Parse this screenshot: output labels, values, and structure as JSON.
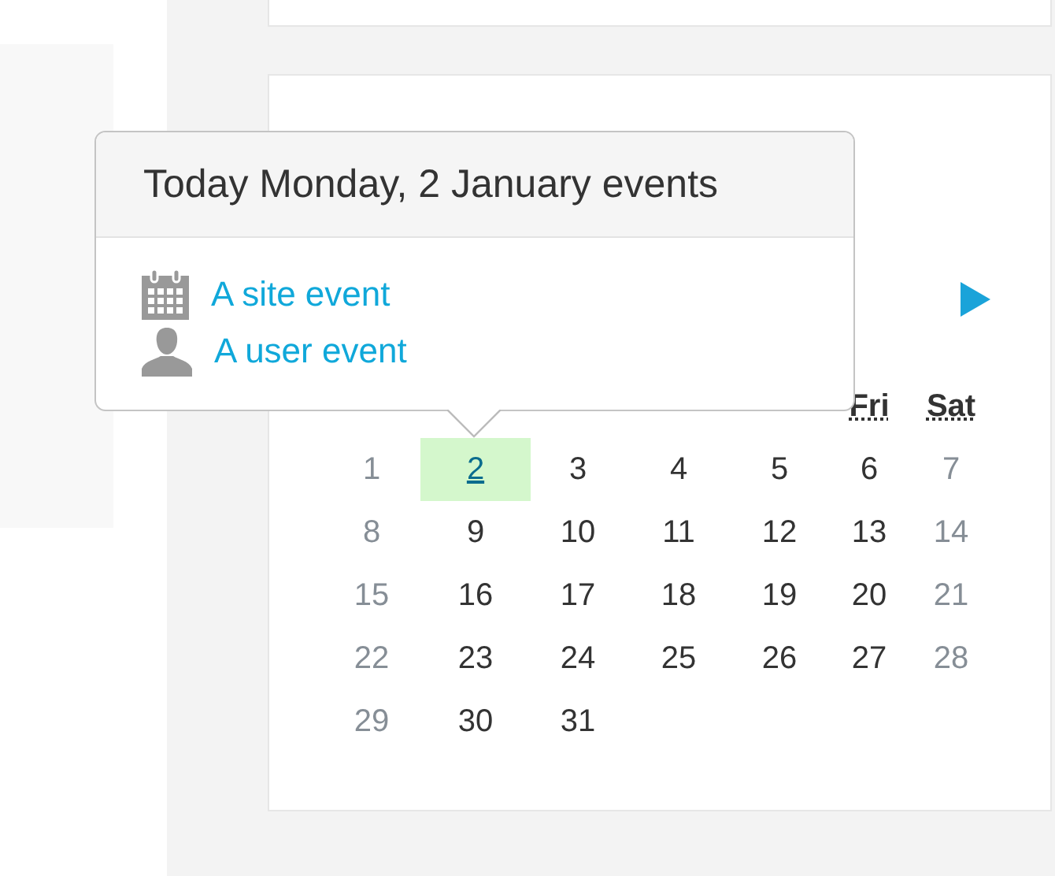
{
  "popover": {
    "title": "Today Monday, 2 January events",
    "events": [
      {
        "kind": "site",
        "label": "A site event"
      },
      {
        "kind": "user",
        "label": "A user event"
      }
    ]
  },
  "calendar": {
    "weekdays": [
      "Fri",
      "Sat"
    ],
    "days": [
      {
        "label": "1",
        "weekend": true,
        "today": false
      },
      {
        "label": "2",
        "weekend": false,
        "today": true
      },
      {
        "label": "3",
        "weekend": false,
        "today": false
      },
      {
        "label": "4",
        "weekend": false,
        "today": false
      },
      {
        "label": "5",
        "weekend": false,
        "today": false
      },
      {
        "label": "6",
        "weekend": false,
        "today": false
      },
      {
        "label": "7",
        "weekend": true,
        "today": false
      },
      {
        "label": "8",
        "weekend": true,
        "today": false
      },
      {
        "label": "9",
        "weekend": false,
        "today": false
      },
      {
        "label": "10",
        "weekend": false,
        "today": false
      },
      {
        "label": "11",
        "weekend": false,
        "today": false
      },
      {
        "label": "12",
        "weekend": false,
        "today": false
      },
      {
        "label": "13",
        "weekend": false,
        "today": false
      },
      {
        "label": "14",
        "weekend": true,
        "today": false
      },
      {
        "label": "15",
        "weekend": true,
        "today": false
      },
      {
        "label": "16",
        "weekend": false,
        "today": false
      },
      {
        "label": "17",
        "weekend": false,
        "today": false
      },
      {
        "label": "18",
        "weekend": false,
        "today": false
      },
      {
        "label": "19",
        "weekend": false,
        "today": false
      },
      {
        "label": "20",
        "weekend": false,
        "today": false
      },
      {
        "label": "21",
        "weekend": true,
        "today": false
      },
      {
        "label": "22",
        "weekend": true,
        "today": false
      },
      {
        "label": "23",
        "weekend": false,
        "today": false
      },
      {
        "label": "24",
        "weekend": false,
        "today": false
      },
      {
        "label": "25",
        "weekend": false,
        "today": false
      },
      {
        "label": "26",
        "weekend": false,
        "today": false
      },
      {
        "label": "27",
        "weekend": false,
        "today": false
      },
      {
        "label": "28",
        "weekend": true,
        "today": false
      },
      {
        "label": "29",
        "weekend": true,
        "today": false
      },
      {
        "label": "30",
        "weekend": false,
        "today": false
      },
      {
        "label": "31",
        "weekend": false,
        "today": false
      }
    ]
  }
}
